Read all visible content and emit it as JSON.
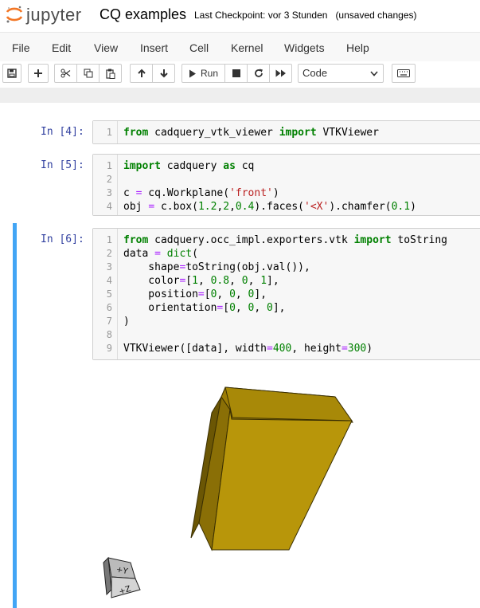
{
  "header": {
    "logo_text": "jupyter",
    "notebook_name": "CQ examples",
    "checkpoint": "Last Checkpoint: vor 3 Stunden",
    "unsaved": "(unsaved changes)"
  },
  "menu": [
    "File",
    "Edit",
    "View",
    "Insert",
    "Cell",
    "Kernel",
    "Widgets",
    "Help"
  ],
  "toolbar": {
    "run_label": "Run",
    "cell_type": "Code",
    "icons": [
      "save-icon",
      "plus-icon",
      "cut-icon",
      "copy-icon",
      "paste-icon",
      "arrow-up-icon",
      "arrow-down-icon",
      "play-icon",
      "stop-icon",
      "restart-icon",
      "fast-forward-icon",
      "keyboard-icon"
    ]
  },
  "cells": [
    {
      "prompt": "In [4]:",
      "lines": [
        {
          "no": "1",
          "text": "from cadquery_vtk_viewer import VTKViewer"
        }
      ]
    },
    {
      "prompt": "In [5]:",
      "lines": [
        {
          "no": "1",
          "text": "import cadquery as cq"
        },
        {
          "no": "2",
          "text": ""
        },
        {
          "no": "3",
          "text": "c = cq.Workplane('front')"
        },
        {
          "no": "4",
          "text": "obj = c.box(1.2,2,0.4).faces('<X').chamfer(0.1)"
        }
      ]
    },
    {
      "prompt": "In [6]:",
      "lines": [
        {
          "no": "1",
          "text": "from cadquery.occ_impl.exporters.vtk import toString"
        },
        {
          "no": "2",
          "text": "data = dict("
        },
        {
          "no": "3",
          "text": "    shape=toString(obj.val()),"
        },
        {
          "no": "4",
          "text": "    color=[1, 0.8, 0, 1],"
        },
        {
          "no": "5",
          "text": "    position=[0, 0, 0],"
        },
        {
          "no": "6",
          "text": "    orientation=[0, 0, 0],"
        },
        {
          "no": "7",
          "text": ")"
        },
        {
          "no": "8",
          "text": ""
        },
        {
          "no": "9",
          "text": "VTKViewer([data], width=400, height=300)"
        }
      ]
    }
  ],
  "viewer": {
    "box_color": "#b8960a",
    "axes_labels": {
      "y": "+Y",
      "z": "+Z"
    }
  },
  "colors": {
    "prompt": "#303f9f",
    "keyword": "#008000",
    "string": "#ba2121",
    "selected_bar": "#42a5f5"
  }
}
